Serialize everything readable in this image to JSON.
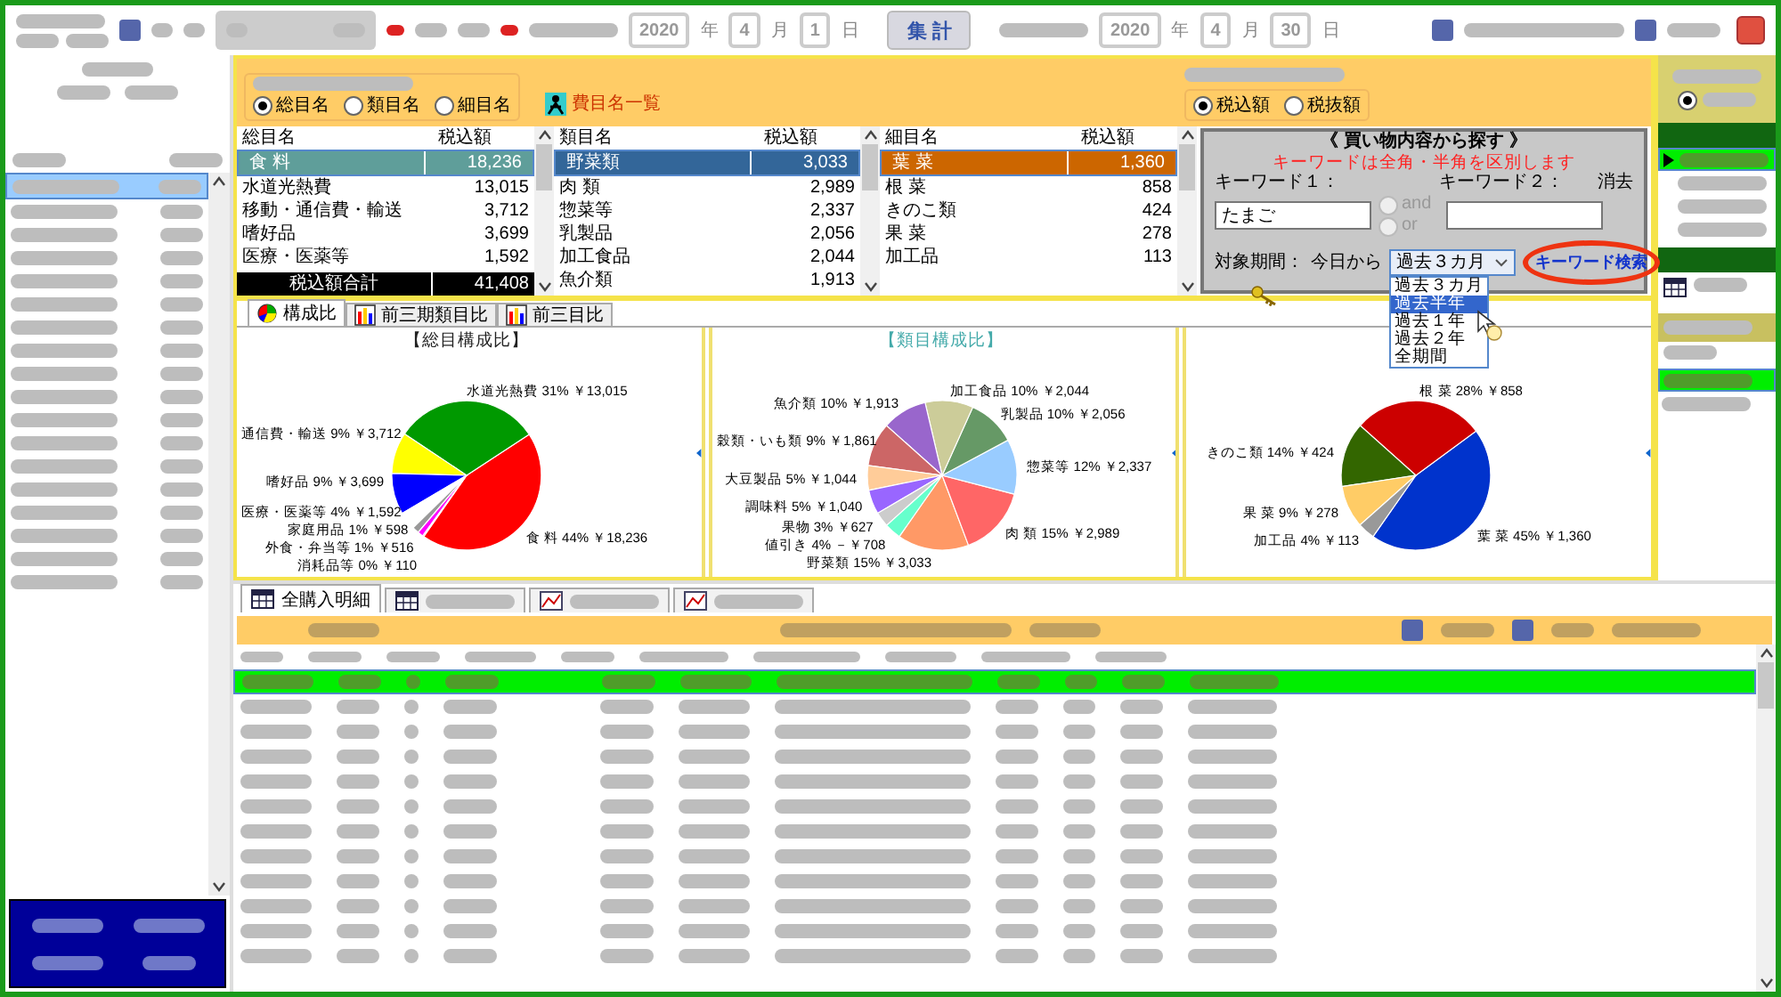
{
  "toolbar": {
    "start": {
      "year": "2020",
      "year_unit": "年",
      "month": "4",
      "month_unit": "月",
      "day": "1",
      "day_unit": "日"
    },
    "total_button": "集 計",
    "end": {
      "year": "2020",
      "year_unit": "年",
      "month": "4",
      "month_unit": "月",
      "day": "30",
      "day_unit": "日"
    }
  },
  "sidebar": {
    "rows": [
      {
        "selected": true
      },
      {
        "selected": false
      },
      {
        "selected": false
      },
      {
        "selected": false
      },
      {
        "selected": false
      },
      {
        "selected": false
      },
      {
        "selected": false
      },
      {
        "selected": false
      },
      {
        "selected": false
      },
      {
        "selected": false
      },
      {
        "selected": false
      },
      {
        "selected": false
      },
      {
        "selected": false
      },
      {
        "selected": false
      },
      {
        "selected": false
      },
      {
        "selected": false
      },
      {
        "selected": false
      },
      {
        "selected": false
      }
    ]
  },
  "display_target": {
    "options": [
      {
        "label": "総目名",
        "selected": true
      },
      {
        "label": "類目名",
        "selected": false
      },
      {
        "label": "細目名",
        "selected": false
      }
    ]
  },
  "category_list_link": "費目名一覧",
  "amount_type": {
    "options": [
      {
        "label": "税込額",
        "selected": true
      },
      {
        "label": "税抜額",
        "selected": false
      }
    ]
  },
  "tables": [
    {
      "columns": [
        "総目名",
        "税込額"
      ],
      "rows": [
        {
          "name": "食 料",
          "amount": "18,236",
          "selected": true
        },
        {
          "name": "水道光熱費",
          "amount": "13,015",
          "selected": false
        },
        {
          "name": "移動・通信費・輸送",
          "amount": "3,712",
          "selected": false
        },
        {
          "name": "嗜好品",
          "amount": "3,699",
          "selected": false
        },
        {
          "name": "医療・医薬等",
          "amount": "1,592",
          "selected": false
        }
      ],
      "total": {
        "label": "税込額合計",
        "amount": "41,408"
      }
    },
    {
      "columns": [
        "類目名",
        "税込額"
      ],
      "rows": [
        {
          "name": "野菜類",
          "amount": "3,033",
          "selected": true
        },
        {
          "name": "肉 類",
          "amount": "2,989",
          "selected": false
        },
        {
          "name": "惣菜等",
          "amount": "2,337",
          "selected": false
        },
        {
          "name": "乳製品",
          "amount": "2,056",
          "selected": false
        },
        {
          "name": "加工食品",
          "amount": "2,044",
          "selected": false
        },
        {
          "name": "魚介類",
          "amount": "1,913",
          "selected": false
        }
      ]
    },
    {
      "columns": [
        "細目名",
        "税込額"
      ],
      "rows": [
        {
          "name": "葉 菜",
          "amount": "1,360",
          "selected": true
        },
        {
          "name": "根 菜",
          "amount": "858",
          "selected": false
        },
        {
          "name": "きのこ類",
          "amount": "424",
          "selected": false
        },
        {
          "name": "果 菜",
          "amount": "278",
          "selected": false
        },
        {
          "name": "加工品",
          "amount": "113",
          "selected": false
        }
      ]
    }
  ],
  "keyword_search": {
    "title": "《 買い物内容から探す 》",
    "note": "キーワードは全角・半角を区別します",
    "keyword1_label": "キーワード１：",
    "keyword2_label": "キーワード２：",
    "clear": "消去",
    "keyword1": "たまご",
    "logic": [
      {
        "label": "and",
        "selected": false,
        "disabled": true
      },
      {
        "label": "or",
        "selected": false,
        "disabled": true
      }
    ],
    "period_label": "対象期間：",
    "from_today": "今日から",
    "period": "過去３カ月",
    "period_options": [
      {
        "label": "過去３カ月",
        "selected": false
      },
      {
        "label": "過去半年",
        "selected": true
      },
      {
        "label": "過去１年",
        "selected": false
      },
      {
        "label": "過去２年",
        "selected": false
      },
      {
        "label": "全期間",
        "selected": false
      }
    ],
    "search_button": "キーワード検索"
  },
  "chart_tabs": [
    {
      "label": "構成比",
      "selected": true
    },
    {
      "label": "前三期類目比",
      "selected": false
    },
    {
      "label": "前三目比",
      "selected": false
    }
  ],
  "charts": [
    {
      "title_highlighted": false,
      "chart_data": {
        "type": "pie",
        "title": "【総目構成比】",
        "categories": [
          "食 料",
          "水道光熱費",
          "通信費・輸送",
          "嗜好品",
          "医療・医薬等",
          "家庭用品",
          "外食・弁当等",
          "消耗品等"
        ],
        "values": [
          18236,
          13015,
          3712,
          3699,
          1592,
          598,
          516,
          110
        ],
        "value_labels": [
          "44% ￥18,236",
          "31% ￥13,015",
          "9% ￥3,712",
          "9% ￥3,699",
          "4% ￥1,592",
          "1% ￥598",
          "1% ￥516",
          "0% ￥110"
        ],
        "colors": [
          "#ff0000",
          "#009900",
          "#ffff00",
          "#0000ff",
          "#ffffff",
          "#999999",
          "#ff00ff",
          "#ff99cc"
        ]
      }
    },
    {
      "title_highlighted": true,
      "chart_data": {
        "type": "pie",
        "title": "【類目構成比】",
        "categories": [
          "野菜類",
          "肉 類",
          "惣菜等",
          "乳製品",
          "加工食品",
          "魚介類",
          "穀類・いも類",
          "大豆製品",
          "調味料",
          "果物",
          "値引き"
        ],
        "values": [
          3033,
          2989,
          2337,
          2056,
          2044,
          1913,
          1861,
          1044,
          1040,
          627,
          708
        ],
        "value_labels": [
          "15% ￥3,033",
          "15% ￥2,989",
          "12% ￥2,337",
          "10% ￥2,056",
          "10% ￥2,044",
          "10% ￥1,913",
          "9% ￥1,861",
          "5% ￥1,044",
          "5% ￥1,040",
          "3% ￥627",
          "4% －￥708"
        ],
        "colors": [
          "#ff9966",
          "#ff6666",
          "#99ccff",
          "#669966",
          "#cccc99",
          "#9966cc",
          "#cc6666",
          "#ffcc99",
          "#9966ff",
          "#cccccc",
          "#66ffcc"
        ]
      }
    },
    {
      "chart_data": {
        "type": "pie",
        "categories": [
          "葉 菜",
          "根 菜",
          "きのこ類",
          "果 菜",
          "加工品"
        ],
        "values": [
          1360,
          858,
          424,
          278,
          113
        ],
        "value_labels": [
          "45% ￥1,360",
          "28% ￥858",
          "14% ￥424",
          "9% ￥278",
          "4% ￥113"
        ],
        "colors": [
          "#0033cc",
          "#cc0000",
          "#336600",
          "#ffcc66",
          "#999999"
        ]
      }
    }
  ],
  "detail_tabs": [
    {
      "label": "全購入明細",
      "selected": true
    },
    {
      "selected": false
    },
    {
      "selected": false
    },
    {
      "selected": false
    }
  ],
  "detail_rows": [
    {
      "selected": true
    },
    {
      "selected": false
    },
    {
      "selected": false
    },
    {
      "selected": false
    },
    {
      "selected": false
    },
    {
      "selected": false
    },
    {
      "selected": false
    },
    {
      "selected": false
    },
    {
      "selected": false
    },
    {
      "selected": false
    },
    {
      "selected": false
    },
    {
      "selected": false
    }
  ],
  "side_radio": {
    "selected": true
  },
  "side_rows": [
    {
      "selected": true
    },
    {
      "selected": false
    },
    {
      "selected": false
    },
    {
      "selected": false
    }
  ],
  "side_dates": [
    {
      "selected": true
    },
    {
      "selected": false
    }
  ]
}
